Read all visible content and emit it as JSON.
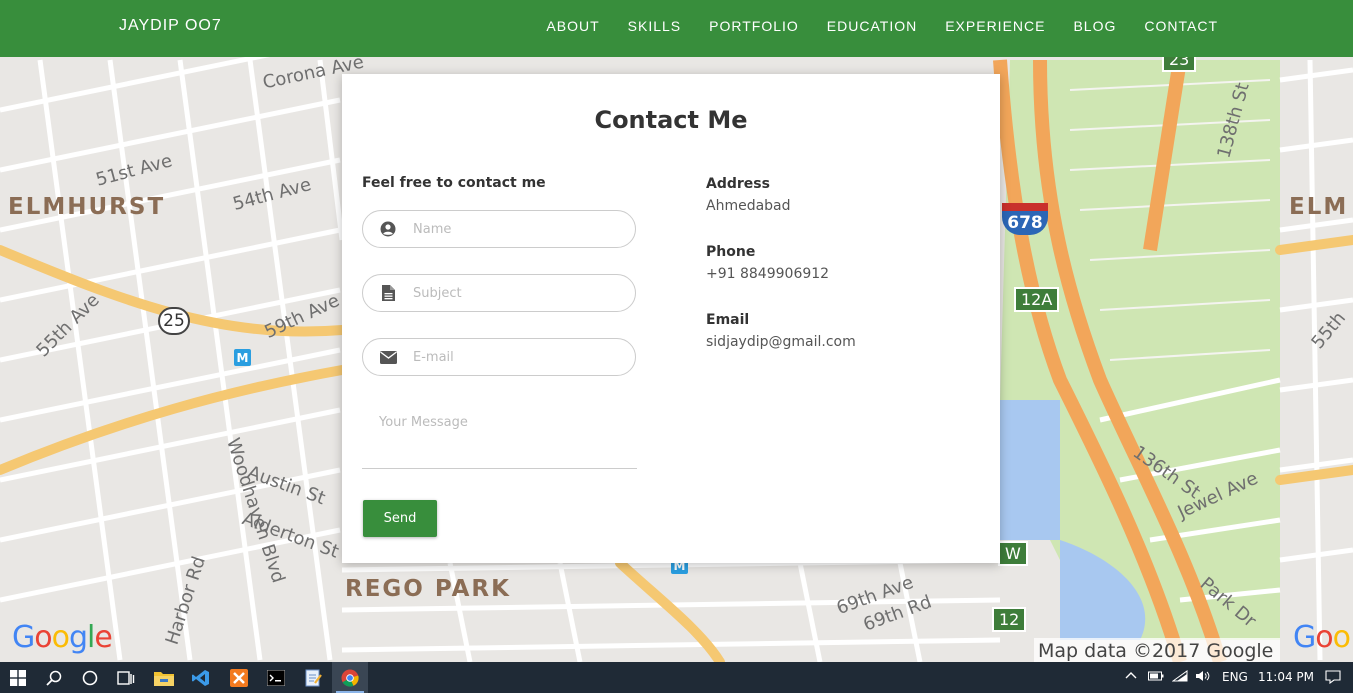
{
  "navbar": {
    "brand": "JAYDIP OO7",
    "links": [
      "ABOUT",
      "SKILLS",
      "PORTFOLIO",
      "EDUCATION",
      "EXPERIENCE",
      "BLOG",
      "CONTACT"
    ]
  },
  "contact": {
    "title": "Contact Me",
    "form_heading": "Feel free to contact me",
    "fields": {
      "name_placeholder": "Name",
      "subject_placeholder": "Subject",
      "email_placeholder": "E-mail",
      "message_placeholder": "Your Message"
    },
    "send_label": "Send",
    "info": {
      "address_label": "Address",
      "address_value": "Ahmedabad",
      "phone_label": "Phone",
      "phone_value": "+91 8849906912",
      "email_label": "Email",
      "email_value": "sidjaydip@gmail.com"
    }
  },
  "map": {
    "districts": [
      "ELMHURST",
      "REGO PARK",
      "ELM"
    ],
    "streets": [
      "Corona Ave",
      "51st Ave",
      "54th Ave",
      "55th Ave",
      "59th Ave",
      "Austin St",
      "Alderton St",
      "Woodhaven Blvd",
      "Harbor Rd",
      "69th Ave",
      "69th Rd",
      "136th St",
      "Jewel Ave",
      "Park Dr",
      "138th St",
      "55th"
    ],
    "shields": {
      "route_25": "25",
      "interstate": "678",
      "exit_12a": "12A",
      "exit_w": "W",
      "exit_12": "12",
      "exit_23": "23"
    },
    "metro": "M",
    "attribution": "Map data ©2017 Google",
    "logo": [
      "G",
      "o",
      "o",
      "g",
      "l",
      "e"
    ]
  },
  "taskbar": {
    "language": "ENG",
    "time": "11:04 PM"
  },
  "colors": {
    "primary_green": "#388e3c",
    "taskbar": "#1f2a36"
  }
}
